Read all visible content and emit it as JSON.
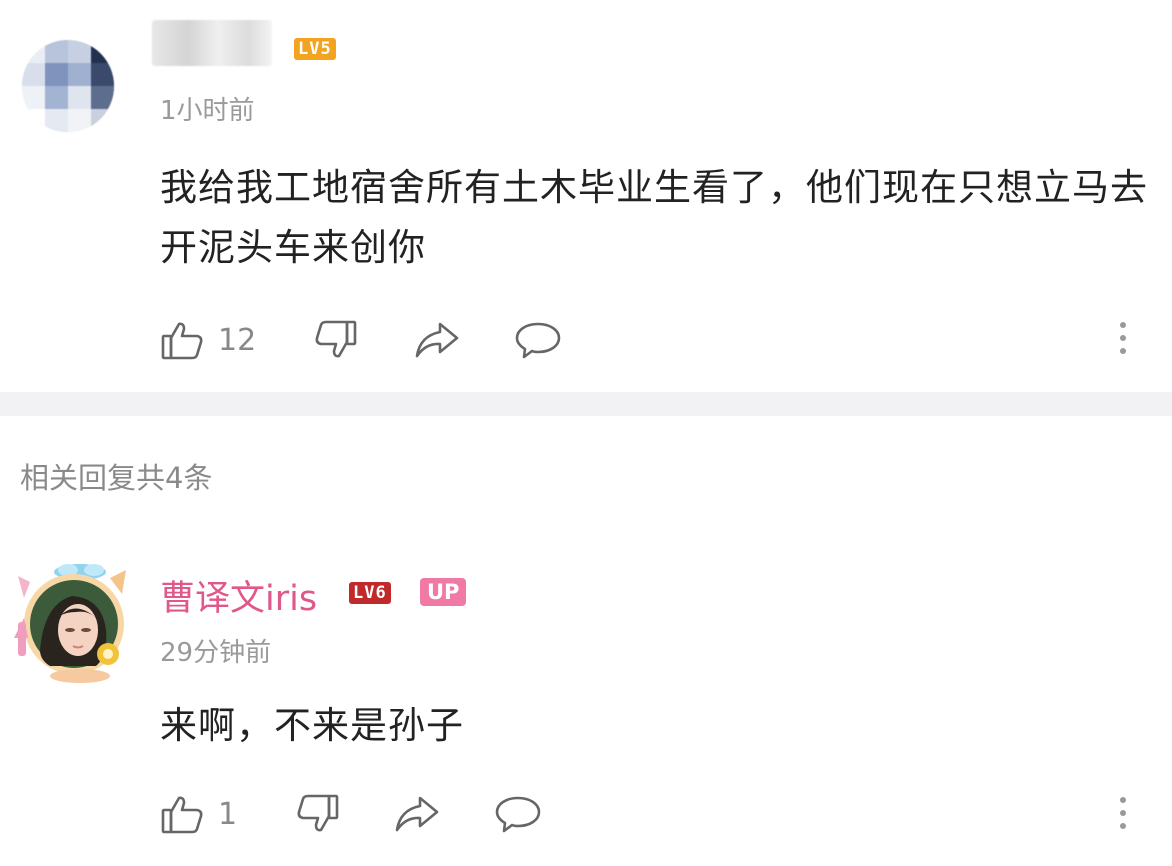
{
  "comment": {
    "level_badge": "LV5",
    "time": "1小时前",
    "text": "我给我工地宿舍所有土木毕业生看了，他们现在只想立马去开泥头车来创你",
    "like_count": "12",
    "icons": [
      "like-icon",
      "dislike-icon",
      "share-icon",
      "reply-icon",
      "more-icon"
    ]
  },
  "replies_header": "相关回复共4条",
  "reply": {
    "username": "曹译文iris",
    "level_badge": "LV6",
    "up_badge": "UP",
    "time": "29分钟前",
    "text": "来啊，不来是孙子",
    "like_count": "1",
    "icons": [
      "like-icon",
      "dislike-icon",
      "share-icon",
      "reply-icon",
      "more-icon"
    ]
  },
  "colors": {
    "username": "#e0578a",
    "lv5_badge": "#f3a31f",
    "lv6_badge": "#c12a2a",
    "up_badge": "#f07aa5",
    "secondary_text": "#9a9a9a"
  }
}
